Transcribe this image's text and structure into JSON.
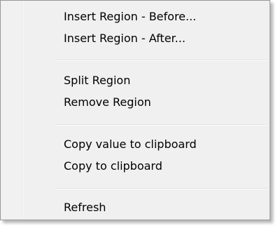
{
  "menu": {
    "group1": [
      {
        "label": "Insert Region - Before..."
      },
      {
        "label": "Insert Region - After..."
      }
    ],
    "group2": [
      {
        "label": "Split Region"
      },
      {
        "label": "Remove Region"
      }
    ],
    "group3": [
      {
        "label": "Copy value to clipboard"
      },
      {
        "label": "Copy to clipboard"
      }
    ],
    "group4": [
      {
        "label": "Refresh"
      }
    ]
  }
}
